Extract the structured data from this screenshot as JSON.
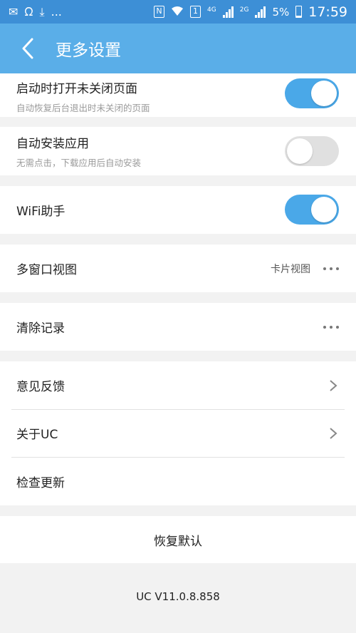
{
  "status_bar": {
    "left_icons": [
      "notification-icon",
      "uc-icon",
      "download-icon",
      "more-notifications"
    ],
    "more_text": "...",
    "nfc_label": "N",
    "sim_label": "1",
    "network_4g": "4G",
    "network_2g": "2G",
    "battery": "5%",
    "time": "17:59"
  },
  "header": {
    "title": "更多设置",
    "back_icon": "back-arrow-icon"
  },
  "settings": {
    "restore_tabs": {
      "title": "启动时打开未关闭页面",
      "subtitle": "自动恢复后台退出时未关闭的页面",
      "enabled": true
    },
    "auto_install": {
      "title": "自动安装应用",
      "subtitle": "无需点击，下载应用后自动安装",
      "enabled": false
    },
    "wifi_helper": {
      "title": "WiFi助手",
      "enabled": true
    },
    "multi_window": {
      "title": "多窗口视图",
      "value": "卡片视图"
    },
    "clear_records": {
      "title": "清除记录"
    },
    "feedback": {
      "title": "意见反馈"
    },
    "about": {
      "title": "关于UC"
    },
    "check_update": {
      "title": "检查更新"
    },
    "restore_default": {
      "title": "恢复默认"
    }
  },
  "version": "UC V11.0.8.858",
  "colors": {
    "status_bar": "#3d8fd6",
    "header": "#5aaee8",
    "toggle_on": "#4aa8e8",
    "toggle_off": "#e0e0e0",
    "background": "#f2f2f2"
  }
}
